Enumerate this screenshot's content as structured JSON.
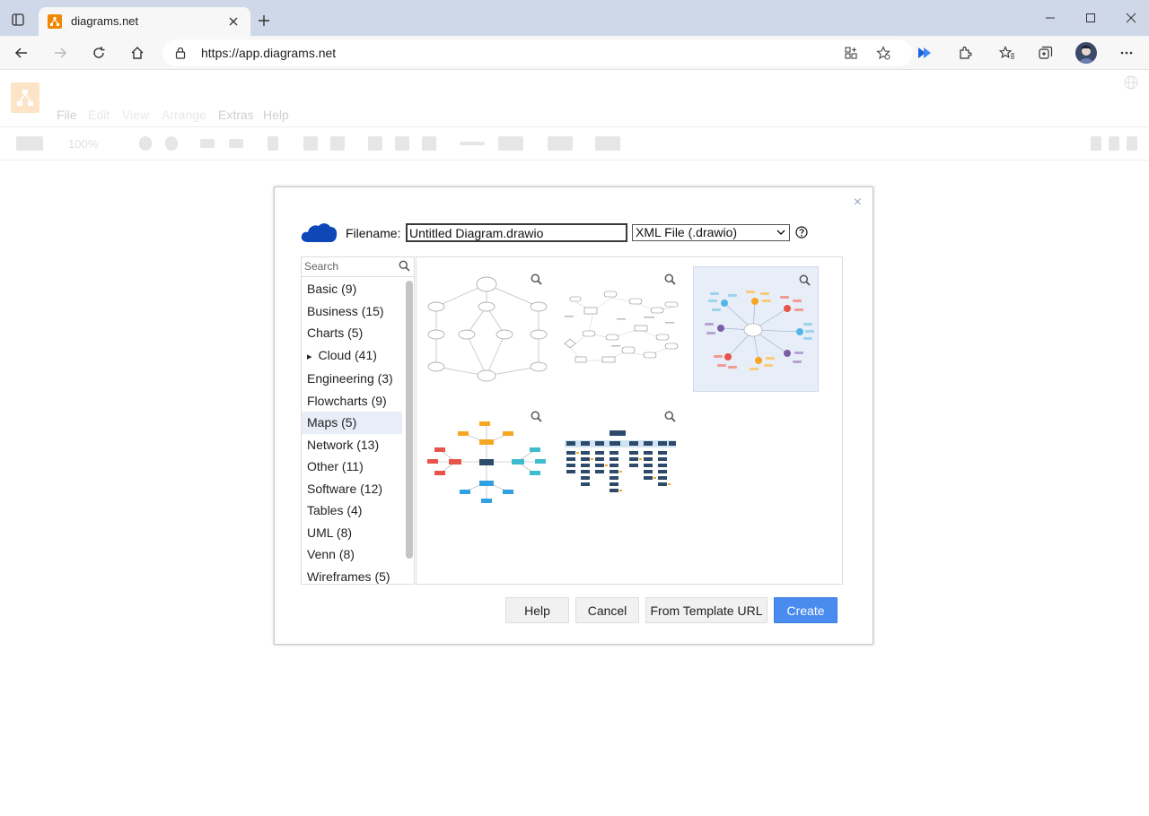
{
  "browser": {
    "tab_title": "diagrams.net",
    "url": "https://app.diagrams.net"
  },
  "app": {
    "menus": [
      "File",
      "Edit",
      "View",
      "Arrange",
      "Extras",
      "Help"
    ],
    "zoom": "100%"
  },
  "dialog": {
    "filename_label": "Filename:",
    "filename_value": "Untitled Diagram.drawio",
    "filetype_value": "XML File (.drawio)",
    "search_placeholder": "Search",
    "categories": [
      {
        "label": "Basic (9)"
      },
      {
        "label": "Business (15)"
      },
      {
        "label": "Charts (5)"
      },
      {
        "label": "Cloud (41)",
        "expand": "▸"
      },
      {
        "label": "Engineering (3)"
      },
      {
        "label": "Flowcharts (9)"
      },
      {
        "label": "Maps (5)",
        "selected": true
      },
      {
        "label": "Network (13)"
      },
      {
        "label": "Other (11)"
      },
      {
        "label": "Software (12)"
      },
      {
        "label": "Tables (4)"
      },
      {
        "label": "UML (8)"
      },
      {
        "label": "Venn (8)"
      },
      {
        "label": "Wireframes (5)"
      }
    ],
    "buttons": {
      "help": "Help",
      "cancel": "Cancel",
      "template_url": "From Template URL",
      "create": "Create"
    },
    "close": "×"
  },
  "colors": {
    "accent": "#4a8bf0",
    "onedrive": "#0d47b8",
    "drawio_orange": "#f08705"
  }
}
